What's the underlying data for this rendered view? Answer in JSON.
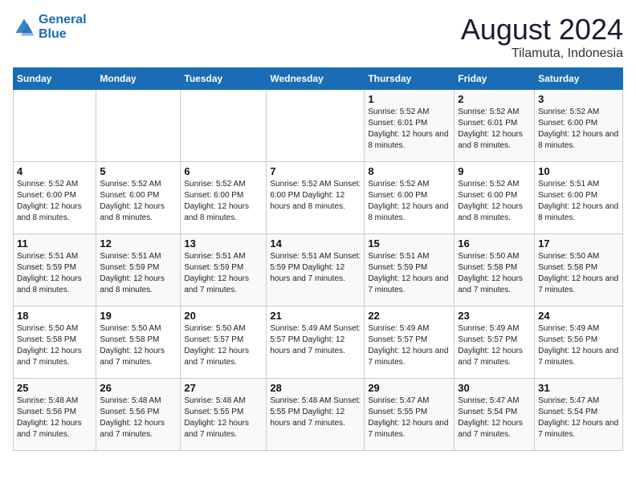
{
  "header": {
    "logo_line1": "General",
    "logo_line2": "Blue",
    "main_title": "August 2024",
    "subtitle": "Tilamuta, Indonesia"
  },
  "days_of_week": [
    "Sunday",
    "Monday",
    "Tuesday",
    "Wednesday",
    "Thursday",
    "Friday",
    "Saturday"
  ],
  "weeks": [
    [
      {
        "day": "",
        "info": ""
      },
      {
        "day": "",
        "info": ""
      },
      {
        "day": "",
        "info": ""
      },
      {
        "day": "",
        "info": ""
      },
      {
        "day": "1",
        "info": "Sunrise: 5:52 AM\nSunset: 6:01 PM\nDaylight: 12 hours\nand 8 minutes."
      },
      {
        "day": "2",
        "info": "Sunrise: 5:52 AM\nSunset: 6:01 PM\nDaylight: 12 hours\nand 8 minutes."
      },
      {
        "day": "3",
        "info": "Sunrise: 5:52 AM\nSunset: 6:00 PM\nDaylight: 12 hours\nand 8 minutes."
      }
    ],
    [
      {
        "day": "4",
        "info": "Sunrise: 5:52 AM\nSunset: 6:00 PM\nDaylight: 12 hours\nand 8 minutes."
      },
      {
        "day": "5",
        "info": "Sunrise: 5:52 AM\nSunset: 6:00 PM\nDaylight: 12 hours\nand 8 minutes."
      },
      {
        "day": "6",
        "info": "Sunrise: 5:52 AM\nSunset: 6:00 PM\nDaylight: 12 hours\nand 8 minutes."
      },
      {
        "day": "7",
        "info": "Sunrise: 5:52 AM\nSunset: 6:00 PM\nDaylight: 12 hours\nand 8 minutes."
      },
      {
        "day": "8",
        "info": "Sunrise: 5:52 AM\nSunset: 6:00 PM\nDaylight: 12 hours\nand 8 minutes."
      },
      {
        "day": "9",
        "info": "Sunrise: 5:52 AM\nSunset: 6:00 PM\nDaylight: 12 hours\nand 8 minutes."
      },
      {
        "day": "10",
        "info": "Sunrise: 5:51 AM\nSunset: 6:00 PM\nDaylight: 12 hours\nand 8 minutes."
      }
    ],
    [
      {
        "day": "11",
        "info": "Sunrise: 5:51 AM\nSunset: 5:59 PM\nDaylight: 12 hours\nand 8 minutes."
      },
      {
        "day": "12",
        "info": "Sunrise: 5:51 AM\nSunset: 5:59 PM\nDaylight: 12 hours\nand 8 minutes."
      },
      {
        "day": "13",
        "info": "Sunrise: 5:51 AM\nSunset: 5:59 PM\nDaylight: 12 hours\nand 7 minutes."
      },
      {
        "day": "14",
        "info": "Sunrise: 5:51 AM\nSunset: 5:59 PM\nDaylight: 12 hours\nand 7 minutes."
      },
      {
        "day": "15",
        "info": "Sunrise: 5:51 AM\nSunset: 5:59 PM\nDaylight: 12 hours\nand 7 minutes."
      },
      {
        "day": "16",
        "info": "Sunrise: 5:50 AM\nSunset: 5:58 PM\nDaylight: 12 hours\nand 7 minutes."
      },
      {
        "day": "17",
        "info": "Sunrise: 5:50 AM\nSunset: 5:58 PM\nDaylight: 12 hours\nand 7 minutes."
      }
    ],
    [
      {
        "day": "18",
        "info": "Sunrise: 5:50 AM\nSunset: 5:58 PM\nDaylight: 12 hours\nand 7 minutes."
      },
      {
        "day": "19",
        "info": "Sunrise: 5:50 AM\nSunset: 5:58 PM\nDaylight: 12 hours\nand 7 minutes."
      },
      {
        "day": "20",
        "info": "Sunrise: 5:50 AM\nSunset: 5:57 PM\nDaylight: 12 hours\nand 7 minutes."
      },
      {
        "day": "21",
        "info": "Sunrise: 5:49 AM\nSunset: 5:57 PM\nDaylight: 12 hours\nand 7 minutes."
      },
      {
        "day": "22",
        "info": "Sunrise: 5:49 AM\nSunset: 5:57 PM\nDaylight: 12 hours\nand 7 minutes."
      },
      {
        "day": "23",
        "info": "Sunrise: 5:49 AM\nSunset: 5:57 PM\nDaylight: 12 hours\nand 7 minutes."
      },
      {
        "day": "24",
        "info": "Sunrise: 5:49 AM\nSunset: 5:56 PM\nDaylight: 12 hours\nand 7 minutes."
      }
    ],
    [
      {
        "day": "25",
        "info": "Sunrise: 5:48 AM\nSunset: 5:56 PM\nDaylight: 12 hours\nand 7 minutes."
      },
      {
        "day": "26",
        "info": "Sunrise: 5:48 AM\nSunset: 5:56 PM\nDaylight: 12 hours\nand 7 minutes."
      },
      {
        "day": "27",
        "info": "Sunrise: 5:48 AM\nSunset: 5:55 PM\nDaylight: 12 hours\nand 7 minutes."
      },
      {
        "day": "28",
        "info": "Sunrise: 5:48 AM\nSunset: 5:55 PM\nDaylight: 12 hours\nand 7 minutes."
      },
      {
        "day": "29",
        "info": "Sunrise: 5:47 AM\nSunset: 5:55 PM\nDaylight: 12 hours\nand 7 minutes."
      },
      {
        "day": "30",
        "info": "Sunrise: 5:47 AM\nSunset: 5:54 PM\nDaylight: 12 hours\nand 7 minutes."
      },
      {
        "day": "31",
        "info": "Sunrise: 5:47 AM\nSunset: 5:54 PM\nDaylight: 12 hours\nand 7 minutes."
      }
    ]
  ]
}
